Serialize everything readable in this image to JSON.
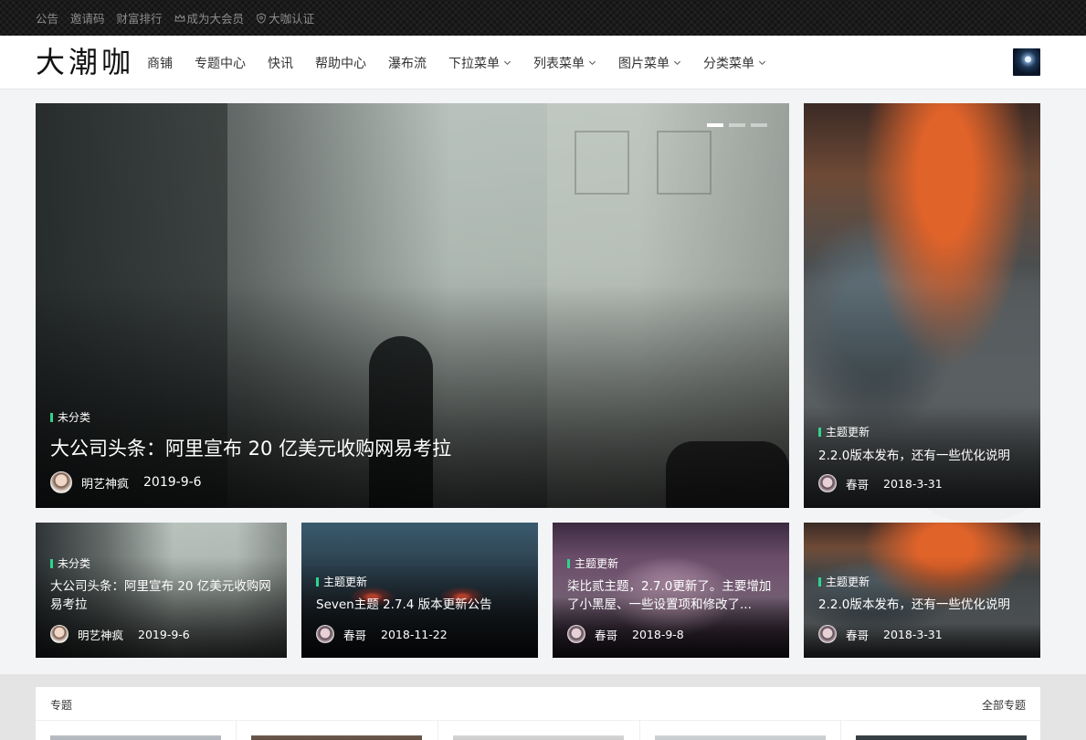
{
  "topbar": {
    "links": [
      "公告",
      "邀请码",
      "财富排行",
      "成为大会员",
      "大咖认证"
    ]
  },
  "nav": {
    "logo": "大潮咖",
    "items": [
      "商铺",
      "专题中心",
      "快讯",
      "帮助中心",
      "瀑布流",
      "下拉菜单",
      "列表菜单",
      "图片菜单",
      "分类菜单"
    ],
    "dropdown_flags": [
      false,
      false,
      false,
      false,
      false,
      true,
      true,
      true,
      true
    ]
  },
  "hero": {
    "tag": "未分类",
    "title": "大公司头条：阿里宣布 20 亿美元收购网易考拉",
    "author": "明艺神疯",
    "date": "2019-9-6"
  },
  "side": {
    "tag": "主题更新",
    "title": "2.2.0版本发布，还有一些优化说明",
    "author": "春哥",
    "date": "2018-3-31"
  },
  "small_cards": [
    {
      "tag": "未分类",
      "title": "大公司头条：阿里宣布 20 亿美元收购网易考拉",
      "author": "明艺神疯",
      "date": "2019-9-6"
    },
    {
      "tag": "主题更新",
      "title": "Seven主题 2.7.4 版本更新公告",
      "author": "春哥",
      "date": "2018-11-22"
    },
    {
      "tag": "主题更新",
      "title": "柒比贰主题，2.7.0更新了。主要增加了小黑屋、一些设置项和修改了...",
      "author": "春哥",
      "date": "2018-9-8"
    },
    {
      "tag": "主题更新",
      "title": "2.2.0版本发布，还有一些优化说明",
      "author": "春哥",
      "date": "2018-3-31"
    }
  ],
  "topics": {
    "heading": "专题",
    "all_link": "全部专题"
  }
}
